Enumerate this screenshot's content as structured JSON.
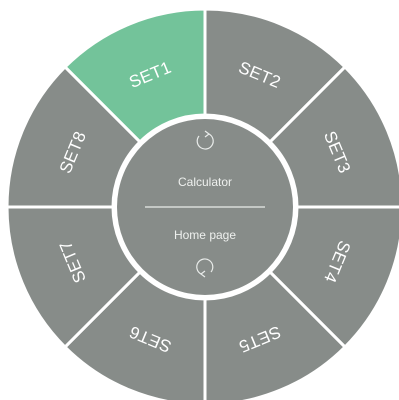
{
  "colors": {
    "segment": "#878c89",
    "active": "#73c39a",
    "center": "#878c89",
    "divider": "#ffffff",
    "text": "#ffffff"
  },
  "segments": [
    {
      "label": "SET1",
      "active": true
    },
    {
      "label": "SET2",
      "active": false
    },
    {
      "label": "SET3",
      "active": false
    },
    {
      "label": "SET4",
      "active": false
    },
    {
      "label": "SET5",
      "active": false
    },
    {
      "label": "SET6",
      "active": false
    },
    {
      "label": "SET7",
      "active": false
    },
    {
      "label": "SET8",
      "active": false
    }
  ],
  "center": {
    "top_label": "Calculator",
    "bottom_label": "Home page",
    "top_icon": "refresh-icon",
    "bottom_icon": "refresh-icon"
  }
}
